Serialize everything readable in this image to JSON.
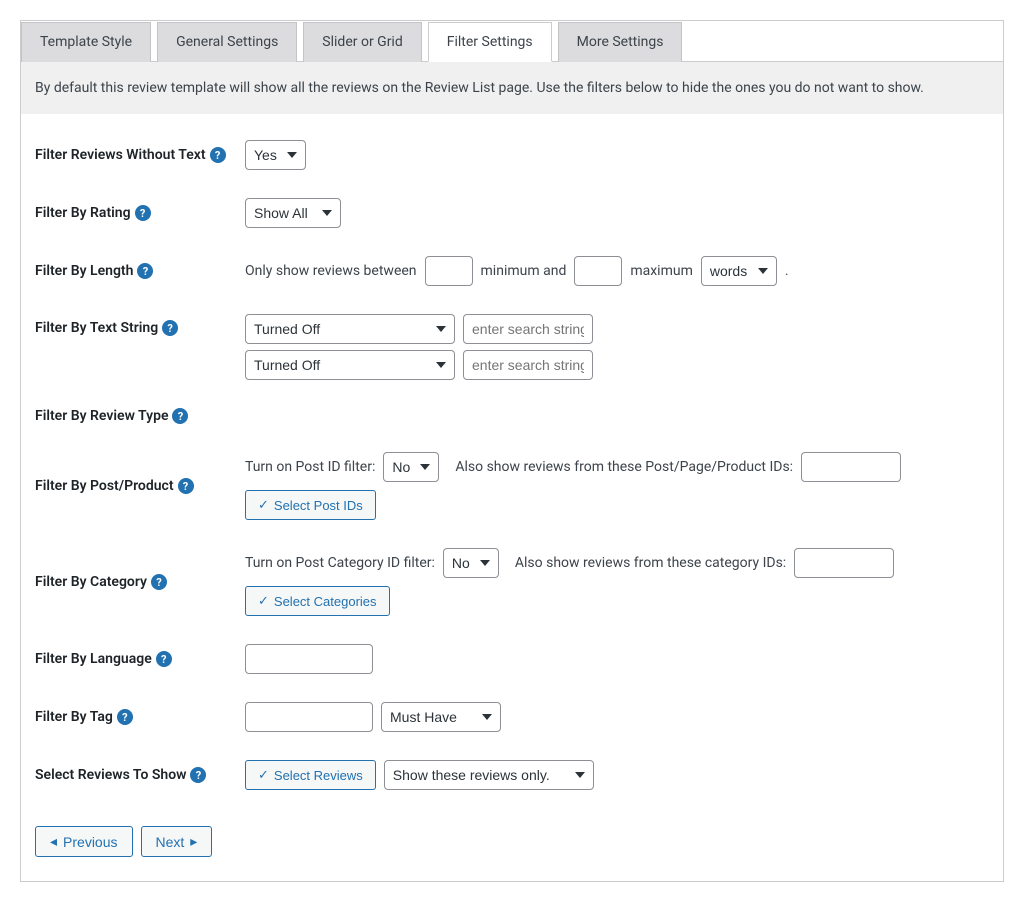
{
  "tabs": {
    "template_style": "Template Style",
    "general_settings": "General Settings",
    "slider_or_grid": "Slider or Grid",
    "filter_settings": "Filter Settings",
    "more_settings": "More Settings"
  },
  "intro": "By default this review template will show all the reviews on the Review List page. Use the filters below to hide the ones you do not want to show.",
  "rows": {
    "without_text": {
      "label": "Filter Reviews Without Text",
      "value": "Yes"
    },
    "by_rating": {
      "label": "Filter By Rating",
      "value": "Show All"
    },
    "by_length": {
      "label": "Filter By Length",
      "prefix": "Only show reviews between",
      "min_label": "minimum and",
      "max_label": "maximum",
      "unit": "words",
      "suffix": "."
    },
    "by_text_string": {
      "label": "Filter By Text String",
      "line1_mode": "Turned Off",
      "line1_placeholder": "enter search string",
      "line2_mode": "Turned Off",
      "line2_placeholder": "enter search string"
    },
    "by_review_type": {
      "label": "Filter By Review Type"
    },
    "by_post_product": {
      "label": "Filter By Post/Product",
      "turn_on_label": "Turn on Post ID filter:",
      "turn_on_value": "No",
      "also_label": "Also show reviews from these Post/Page/Product IDs:",
      "button": "Select Post IDs"
    },
    "by_category": {
      "label": "Filter By Category",
      "turn_on_label": "Turn on Post Category ID filter:",
      "turn_on_value": "No",
      "also_label": "Also show reviews from these category IDs:",
      "button": "Select Categories"
    },
    "by_language": {
      "label": "Filter By Language"
    },
    "by_tag": {
      "label": "Filter By Tag",
      "mode": "Must Have"
    },
    "select_reviews": {
      "label": "Select Reviews To Show",
      "button": "Select Reviews",
      "mode": "Show these reviews only."
    }
  },
  "nav": {
    "previous": "Previous",
    "next": "Next"
  }
}
